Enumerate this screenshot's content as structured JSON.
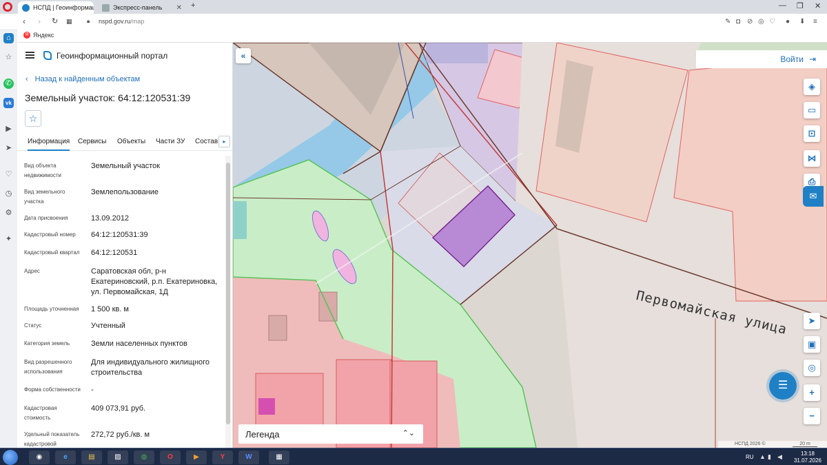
{
  "browser": {
    "tabs": [
      {
        "title": "НСПД | Геоинформационн",
        "active": true
      },
      {
        "title": "Экспресс-панель",
        "active": false
      }
    ],
    "url_host": "nspd.gov.ru",
    "url_path": "/map",
    "bookmarks": [
      {
        "label": "Яндекс"
      }
    ]
  },
  "panel": {
    "portal_title": "Геоинформационный портал",
    "back_label": "Назад к найденным объектам",
    "object_title": "Земельный участок: 64:12:120531:39",
    "tabs": [
      "Информация",
      "Сервисы",
      "Объекты",
      "Части ЗУ",
      "Состав"
    ],
    "properties": [
      {
        "label": "Вид объекта недвижимости",
        "value": "Земельный участок"
      },
      {
        "label": "Вид земельного участка",
        "value": "Землепользование"
      },
      {
        "label": "Дата присвоения",
        "value": "13.09.2012"
      },
      {
        "label": "Кадастровый номер",
        "value": "64:12:120531:39"
      },
      {
        "label": "Кадастровый квартал",
        "value": "64:12:120531"
      },
      {
        "label": "Адрес",
        "value": "Саратовская обл, р-н Екатериновский, р.п. Екатериновка, ул. Первомайская, 1Д"
      },
      {
        "label": "Площадь уточненная",
        "value": "1 500 кв. м"
      },
      {
        "label": "Статус",
        "value": "Учтенный"
      },
      {
        "label": "Категория земель",
        "value": "Земли населенных пунктов"
      },
      {
        "label": "Вид разрешенного использования",
        "value": "Для индивидуального жилищного строительства"
      },
      {
        "label": "Форма собственности",
        "value": "-"
      },
      {
        "label": "Кадастровая стоимость",
        "value": "409 073,91 руб."
      },
      {
        "label": "Удельный показатель кадастровой",
        "value": "272,72 руб./кв. м"
      }
    ]
  },
  "map": {
    "login_label": "Войти",
    "legend_label": "Легенда",
    "street_label": "Первомайская улица",
    "attribution": "НСПД 2026 ©",
    "scale_label": "20 m",
    "colors": {
      "parcel_fill": "#e6dfdb",
      "selected_parcel": "#b88ad6",
      "green_zone": "#c9eec7",
      "pink_zone": "#f6b3b8",
      "water": "#8fc8e8"
    }
  },
  "taskbar": {
    "language": "RU",
    "time": "13:18",
    "date": "31.07.2026"
  }
}
